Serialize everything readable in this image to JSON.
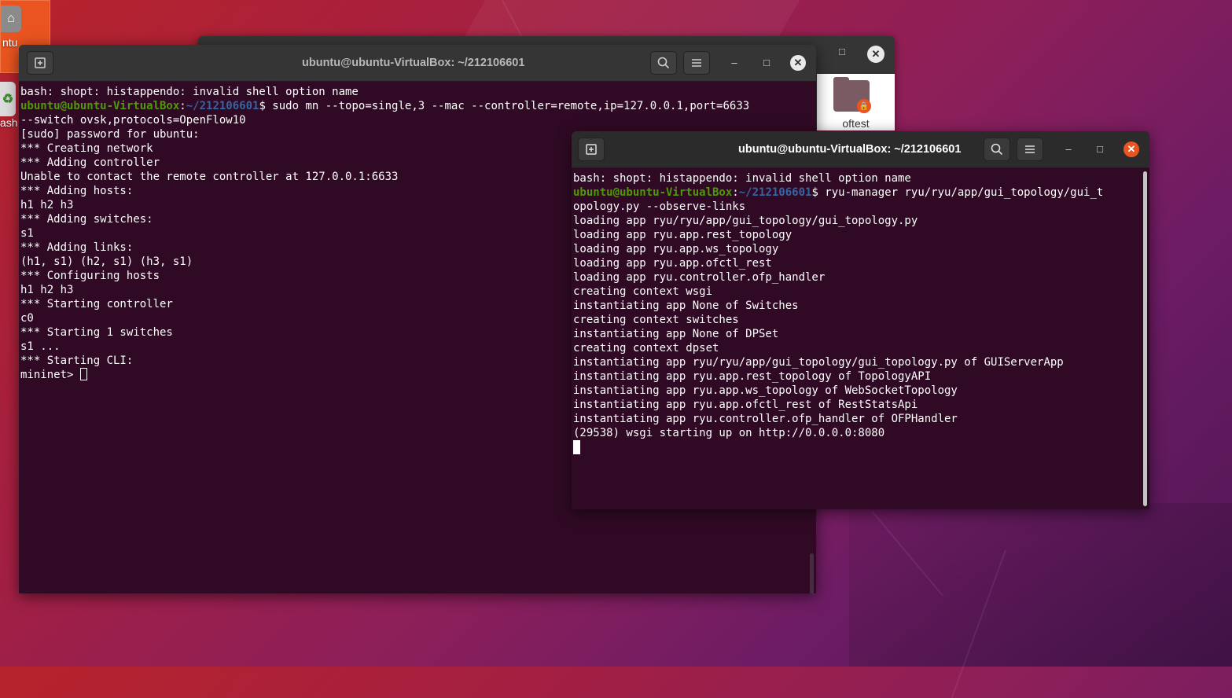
{
  "desktop": {
    "home_label": "ntu",
    "trash_label": "ash",
    "folder_label": "oftest"
  },
  "window_back": {
    "title": "ubuntu@ubuntu-VirtualBox: ~/212106601",
    "lines": [
      {
        "text": "bash: shopt: histappendo: invalid shell option name"
      },
      {
        "user": "ubuntu@ubuntu-VirtualBox",
        "path": "~/212106601",
        "cmd": "$ sudo mn --topo=single,3 --mac --controller=remote,ip=127.0.0.1,port=6633"
      },
      {
        "text": "--switch ovsk,protocols=OpenFlow10"
      },
      {
        "text": "[sudo] password for ubuntu:"
      },
      {
        "text": "*** Creating network"
      },
      {
        "text": "*** Adding controller"
      },
      {
        "text": "Unable to contact the remote controller at 127.0.0.1:6633"
      },
      {
        "text": "*** Adding hosts:"
      },
      {
        "text": "h1 h2 h3"
      },
      {
        "text": "*** Adding switches:"
      },
      {
        "text": "s1"
      },
      {
        "text": "*** Adding links:"
      },
      {
        "text": "(h1, s1) (h2, s1) (h3, s1)"
      },
      {
        "text": "*** Configuring hosts"
      },
      {
        "text": "h1 h2 h3"
      },
      {
        "text": "*** Starting controller"
      },
      {
        "text": "c0"
      },
      {
        "text": "*** Starting 1 switches"
      },
      {
        "text": "s1 ..."
      },
      {
        "text": "*** Starting CLI:"
      },
      {
        "text": "mininet> ",
        "cursor": "box"
      }
    ]
  },
  "window_front": {
    "title": "ubuntu@ubuntu-VirtualBox: ~/212106601",
    "lines": [
      {
        "text": "bash: shopt: histappendo: invalid shell option name"
      },
      {
        "user": "ubuntu@ubuntu-VirtualBox",
        "path": "~/212106601",
        "cmd": "$ ryu-manager ryu/ryu/app/gui_topology/gui_t"
      },
      {
        "text": "opology.py --observe-links"
      },
      {
        "text": "loading app ryu/ryu/app/gui_topology/gui_topology.py"
      },
      {
        "text": "loading app ryu.app.rest_topology"
      },
      {
        "text": "loading app ryu.app.ws_topology"
      },
      {
        "text": "loading app ryu.app.ofctl_rest"
      },
      {
        "text": "loading app ryu.controller.ofp_handler"
      },
      {
        "text": "creating context wsgi"
      },
      {
        "text": "instantiating app None of Switches"
      },
      {
        "text": "creating context switches"
      },
      {
        "text": "instantiating app None of DPSet"
      },
      {
        "text": "creating context dpset"
      },
      {
        "text": "instantiating app ryu/ryu/app/gui_topology/gui_topology.py of GUIServerApp"
      },
      {
        "text": "instantiating app ryu.app.rest_topology of TopologyAPI"
      },
      {
        "text": "instantiating app ryu.app.ws_topology of WebSocketTopology"
      },
      {
        "text": "instantiating app ryu.app.ofctl_rest of RestStatsApi"
      },
      {
        "text": "instantiating app ryu.controller.ofp_handler of OFPHandler"
      },
      {
        "text": "(29538) wsgi starting up on http://0.0.0.0:8080"
      },
      {
        "text": "",
        "cursor": "block"
      }
    ]
  },
  "icons": {
    "new_tab": "new-tab-icon",
    "search": "search-icon",
    "menu": "hamburger-menu-icon",
    "minimize": "minimize-icon",
    "maximize": "maximize-icon",
    "close": "close-icon"
  },
  "colors": {
    "terminal_bg": "#300a24",
    "prompt_user": "#4e9a06",
    "prompt_path": "#3465a4",
    "close_active": "#e95420",
    "titlebar": "#2b2b2b"
  }
}
